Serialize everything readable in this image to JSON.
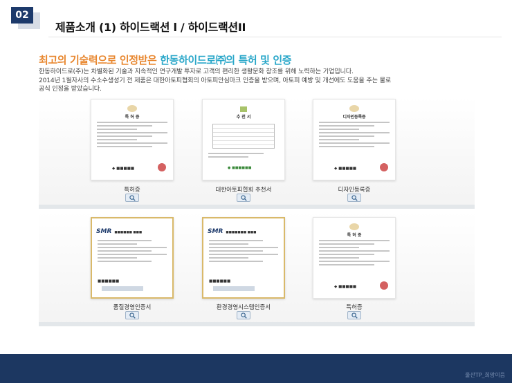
{
  "header": {
    "slide_number": "02",
    "title_main": "제품소개 (1) 하이드랙션",
    "title_sep": " l / ",
    "title_sub": "하이드랙션II"
  },
  "headline": {
    "part_a": "최고의 기술력으로 인정받은 ",
    "part_b": "한동하이드로㈜의 특허 및 인증"
  },
  "description": {
    "line1": "한동하이드로(주)는 차별화된 기술과 지속적인 연구개발 투자로 고객의 편리한 생활문화 창조를 위해 노력하는 기업입니다.",
    "line2": "2014년 1월자사의 수소수생성기 전 제품은 대한아토피협회의 아토피안심마크 인증을 받으며, 아토피 예방 및 개선에도 도움을 주는 물로",
    "line3": "공식 인정을 받았습니다."
  },
  "certificates": [
    {
      "caption": "특허증",
      "doc_title": "특 허 증"
    },
    {
      "caption": "대한아토피협회 추천서",
      "doc_title": "추 천 서"
    },
    {
      "caption": "디자인등록증",
      "doc_title": "디자인등록증"
    },
    {
      "caption": "품질경영인증서",
      "doc_title": "SMR"
    },
    {
      "caption": "환경경영시스템인증서",
      "doc_title": "SMR"
    },
    {
      "caption": "특허증",
      "doc_title": "특 허 증"
    }
  ],
  "footer": {
    "text": "울산TP_희망이음"
  },
  "colors": {
    "accent_orange": "#e8872f",
    "accent_cyan": "#2aa7c9",
    "navy": "#1c3761"
  },
  "icons": {
    "zoom": "magnifier-icon"
  }
}
